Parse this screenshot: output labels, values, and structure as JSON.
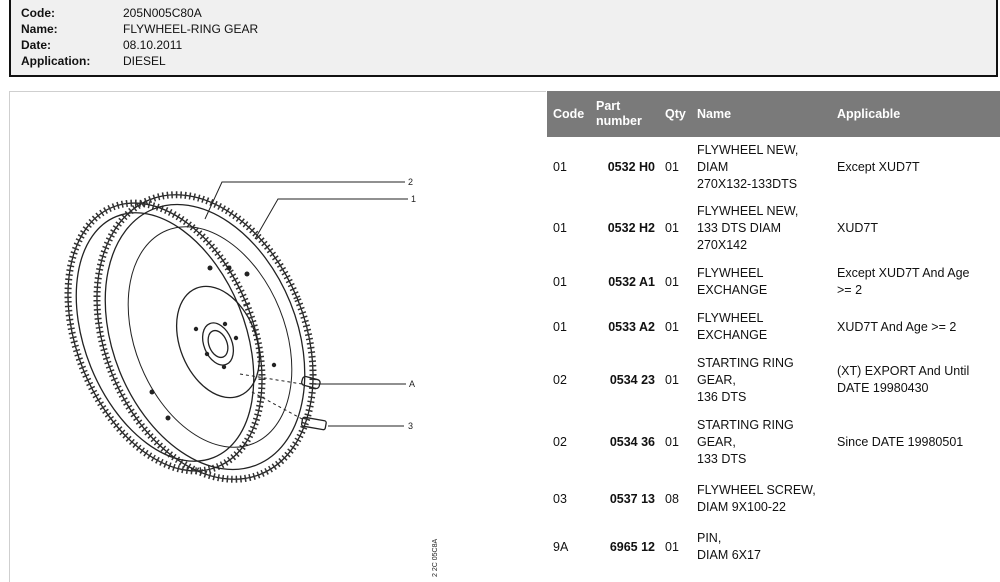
{
  "header": {
    "code_label": "Code:",
    "code_value": "205N005C80A",
    "name_label": "Name:",
    "name_value": "FLYWHEEL-RING GEAR",
    "date_label": "Date:",
    "date_value": "08.10.2011",
    "application_label": "Application:",
    "application_value": "DIESEL"
  },
  "drawing": {
    "callouts": [
      "2",
      "1",
      "A",
      "3"
    ],
    "vertical_code": "2 2C 05C8A"
  },
  "table": {
    "columns": {
      "code": "Code",
      "part_number_line1": "Part",
      "part_number_line2": "number",
      "qty": "Qty",
      "name": "Name",
      "applicable": "Applicable"
    },
    "rows": [
      {
        "code": "01",
        "part_number": "0532 H0",
        "qty": "01",
        "name": [
          "FLYWHEEL NEW,",
          "DIAM",
          "270X132-133DTS"
        ],
        "applicable": [
          "Except XUD7T"
        ]
      },
      {
        "code": "01",
        "part_number": "0532 H2",
        "qty": "01",
        "name": [
          "FLYWHEEL NEW,",
          "133 DTS DIAM",
          "270X142"
        ],
        "applicable": [
          "XUD7T"
        ]
      },
      {
        "code": "01",
        "part_number": "0532 A1",
        "qty": "01",
        "name": [
          "FLYWHEEL",
          "EXCHANGE"
        ],
        "applicable": [
          "Except XUD7T And Age",
          ">= 2"
        ]
      },
      {
        "code": "01",
        "part_number": "0533 A2",
        "qty": "01",
        "name": [
          "FLYWHEEL",
          "EXCHANGE"
        ],
        "applicable": [
          "XUD7T And Age >= 2"
        ]
      },
      {
        "code": "02",
        "part_number": "0534 23",
        "qty": "01",
        "name": [
          "STARTING RING",
          "GEAR,",
          "136 DTS"
        ],
        "applicable": [
          "(XT) EXPORT And Until",
          "DATE 19980430"
        ]
      },
      {
        "code": "02",
        "part_number": "0534 36",
        "qty": "01",
        "name": [
          "STARTING RING",
          "GEAR,",
          "133 DTS"
        ],
        "applicable": [
          "Since DATE 19980501"
        ]
      },
      {
        "code": "03",
        "part_number": "0537 13",
        "qty": "08",
        "name": [
          "FLYWHEEL SCREW,",
          "DIAM 9X100-22"
        ],
        "applicable": [
          ""
        ]
      },
      {
        "code": "9A",
        "part_number": "6965 12",
        "qty": "01",
        "name": [
          "PIN,",
          "DIAM 6X17"
        ],
        "applicable": [
          ""
        ]
      }
    ]
  }
}
